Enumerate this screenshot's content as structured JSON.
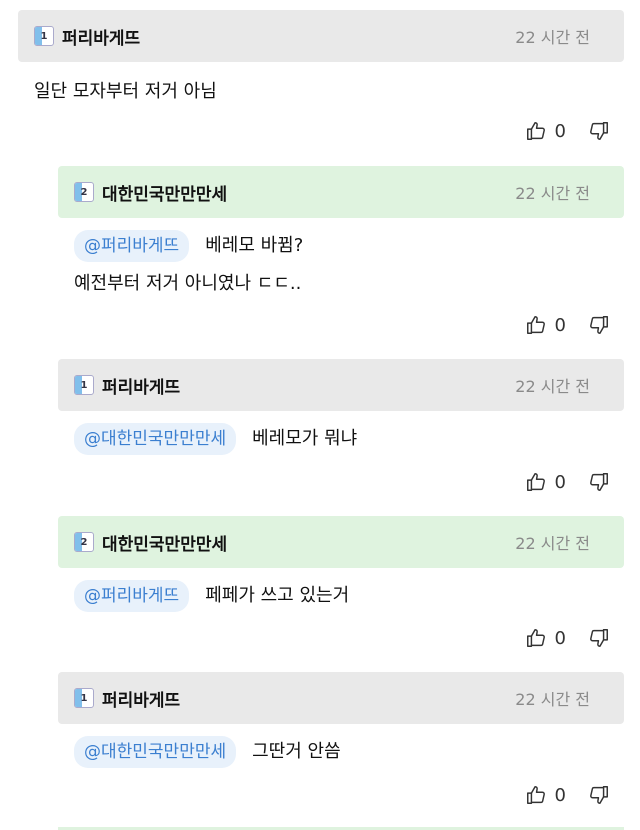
{
  "comments": [
    {
      "author": "퍼리바게뜨",
      "level": "1",
      "time": "22 시간 전",
      "mention": "",
      "lines": [
        "일단 모자부터 저거 아님"
      ],
      "likes": "0",
      "style": "gray"
    },
    {
      "author": "대한민국만만만세",
      "level": "2",
      "time": "22 시간 전",
      "mention": "@퍼리바게뜨",
      "lines": [
        "베레모 바뀜?",
        "예전부터 저거 아니였나 ㄷㄷ.."
      ],
      "likes": "0",
      "style": "green"
    },
    {
      "author": "퍼리바게뜨",
      "level": "1",
      "time": "22 시간 전",
      "mention": "@대한민국만만만세",
      "lines": [
        "베레모가 뭐냐"
      ],
      "likes": "0",
      "style": "gray"
    },
    {
      "author": "대한민국만만만세",
      "level": "2",
      "time": "22 시간 전",
      "mention": "@퍼리바게뜨",
      "lines": [
        "페페가 쓰고 있는거"
      ],
      "likes": "0",
      "style": "green"
    },
    {
      "author": "퍼리바게뜨",
      "level": "1",
      "time": "22 시간 전",
      "mention": "@대한민국만만만세",
      "lines": [
        "그딴거 안씀"
      ],
      "likes": "0",
      "style": "gray"
    }
  ],
  "icons": {
    "like": "thumbs-up-icon",
    "dislike": "thumbs-down-icon",
    "level": "level-badge-icon"
  }
}
